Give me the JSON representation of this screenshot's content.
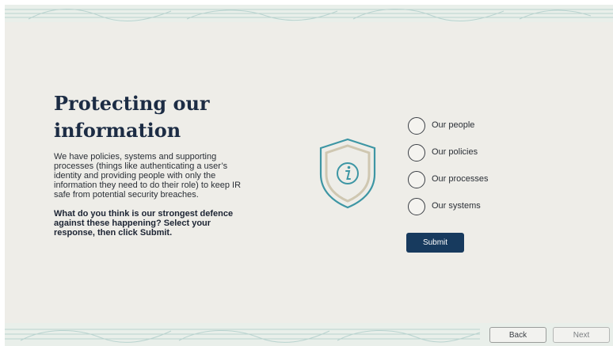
{
  "slide": {
    "title": "Protecting our information",
    "body": "We have policies, systems and supporting processes (things like authenticating a user’s identity and providing people with only the information they need to do their role) to keep IR safe from potential security breaches.",
    "question": "What do you think is our strongest defence against these happening? Select your response, then click Submit."
  },
  "options": [
    {
      "label": "Our people",
      "selected": false
    },
    {
      "label": "Our policies",
      "selected": false
    },
    {
      "label": "Our processes",
      "selected": false
    },
    {
      "label": "Our systems",
      "selected": false
    }
  ],
  "submit_label": "Submit",
  "navigation": {
    "back_label": "Back",
    "next_label": "Next",
    "next_enabled": false
  },
  "icons": {
    "shield": "shield-info-icon",
    "option": "radio-button"
  },
  "colors": {
    "background": "#eeede8",
    "title": "#1c2c44",
    "accent_teal": "#3d96a4",
    "shield_inner": "#cfc7b1",
    "submit": "#173a5e"
  }
}
